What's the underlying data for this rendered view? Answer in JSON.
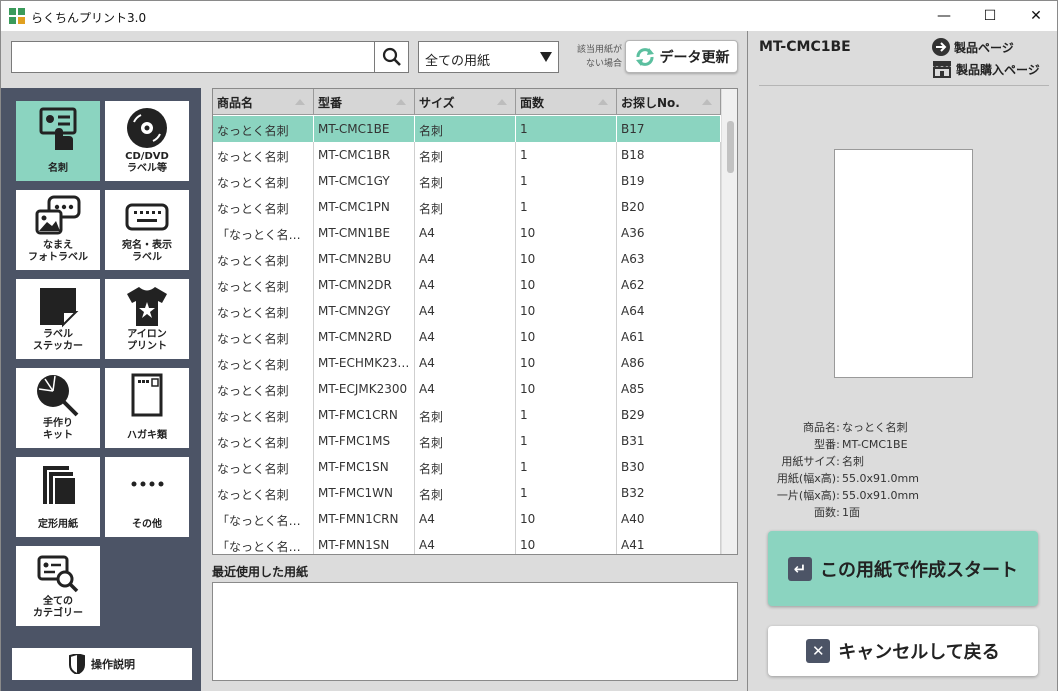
{
  "app": {
    "title": "らくちんプリント3.0"
  },
  "window": {
    "minimize": "—",
    "maximize": "☐",
    "close": "✕"
  },
  "search": {
    "value": "",
    "placeholder": ""
  },
  "paper_filter": {
    "selected": "全ての用紙"
  },
  "no_paper_note": "該当用紙が\nない場合",
  "data_update": {
    "label": "データ更新"
  },
  "categories": [
    {
      "label": "名刺",
      "icon": "business-card-icon",
      "active": true
    },
    {
      "label": "CD/DVD\nラベル等",
      "icon": "disc-icon",
      "active": false
    },
    {
      "label": "なまえ\nフォトラベル",
      "icon": "photo-label-icon",
      "active": false
    },
    {
      "label": "宛名・表示\nラベル",
      "icon": "keyboard-label-icon",
      "active": false
    },
    {
      "label": "ラベル\nステッカー",
      "icon": "sticker-icon",
      "active": false
    },
    {
      "label": "アイロン\nプリント",
      "icon": "tshirt-icon",
      "active": false
    },
    {
      "label": "手作り\nキット",
      "icon": "fan-icon",
      "active": false
    },
    {
      "label": "ハガキ類",
      "icon": "postcard-icon",
      "active": false
    },
    {
      "label": "定形用紙",
      "icon": "paper-stack-icon",
      "active": false
    },
    {
      "label": "その他",
      "icon": "more-icon",
      "active": false
    },
    {
      "label": "全ての\nカテゴリー",
      "icon": "search-category-icon",
      "active": false
    }
  ],
  "manual": {
    "label": "操作説明"
  },
  "table": {
    "headers": [
      "商品名",
      "型番",
      "サイズ",
      "面数",
      "お探しNo."
    ],
    "rows": [
      [
        "なっとく名刺",
        "MT-CMC1BE",
        "名刺",
        "1",
        "B17"
      ],
      [
        "なっとく名刺",
        "MT-CMC1BR",
        "名刺",
        "1",
        "B18"
      ],
      [
        "なっとく名刺",
        "MT-CMC1GY",
        "名刺",
        "1",
        "B19"
      ],
      [
        "なっとく名刺",
        "MT-CMC1PN",
        "名刺",
        "1",
        "B20"
      ],
      [
        "「なっとく名刺…",
        "MT-CMN1BE",
        "A4",
        "10",
        "A36"
      ],
      [
        "なっとく名刺",
        "MT-CMN2BU",
        "A4",
        "10",
        "A63"
      ],
      [
        "なっとく名刺",
        "MT-CMN2DR",
        "A4",
        "10",
        "A62"
      ],
      [
        "なっとく名刺",
        "MT-CMN2GY",
        "A4",
        "10",
        "A64"
      ],
      [
        "なっとく名刺",
        "MT-CMN2RD",
        "A4",
        "10",
        "A61"
      ],
      [
        "なっとく名刺",
        "MT-ECHMK23…",
        "A4",
        "10",
        "A86"
      ],
      [
        "なっとく名刺",
        "MT-ECJMK2300",
        "A4",
        "10",
        "A85"
      ],
      [
        "なっとく名刺",
        "MT-FMC1CRN",
        "名刺",
        "1",
        "B29"
      ],
      [
        "なっとく名刺",
        "MT-FMC1MS",
        "名刺",
        "1",
        "B31"
      ],
      [
        "なっとく名刺",
        "MT-FMC1SN",
        "名刺",
        "1",
        "B30"
      ],
      [
        "なっとく名刺",
        "MT-FMC1WN",
        "名刺",
        "1",
        "B32"
      ],
      [
        "「なっとく名刺…",
        "MT-FMN1CRN",
        "A4",
        "10",
        "A40"
      ],
      [
        "「なっとく名刺…",
        "MT-FMN1SN",
        "A4",
        "10",
        "A41"
      ]
    ],
    "selected_index": 0
  },
  "recent": {
    "label": "最近使用した用紙"
  },
  "preview": {
    "code": "MT-CMC1BE",
    "product_page": "製品ページ",
    "buy_page": "製品購入ページ",
    "info": [
      {
        "key": "商品名",
        "value": "なっとく名刺"
      },
      {
        "key": "型番",
        "value": "MT-CMC1BE"
      },
      {
        "key": "用紙サイズ",
        "value": "名刺"
      },
      {
        "key": "用紙(幅x高)",
        "value": "55.0x91.0mm"
      },
      {
        "key": "一片(幅x高)",
        "value": "55.0x91.0mm"
      },
      {
        "key": "面数",
        "value": "1面"
      }
    ],
    "start_label": "この用紙で作成スタート",
    "cancel_label": "キャンセルして戻る"
  },
  "colors": {
    "accent": "#8bd4c0",
    "panel": "#4c5466"
  }
}
